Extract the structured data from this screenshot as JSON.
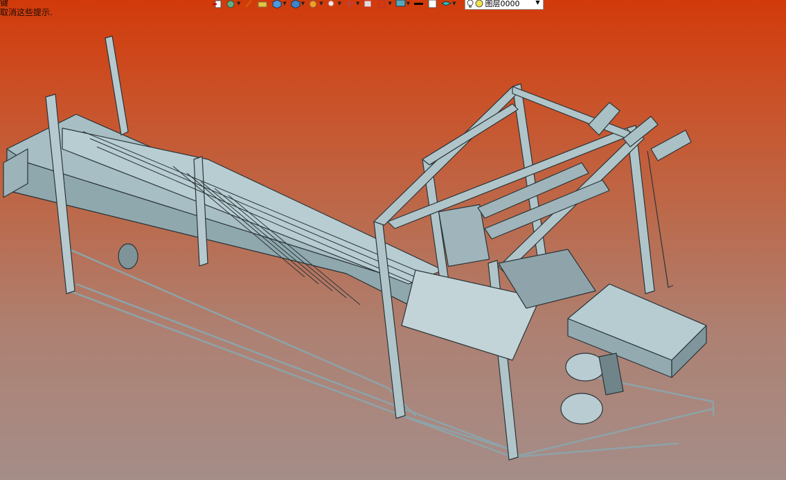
{
  "status_hint": {
    "line1": "键",
    "line2": "取消这些提示."
  },
  "toolbar": {
    "icons": [
      "insert-icon",
      "rebuild-icon",
      "sketch-icon",
      "color-icon",
      "box-icon",
      "view-orient-icon",
      "render-icon",
      "zoom-icon",
      "section-icon",
      "display-icon",
      "hide-icon",
      "monitor-icon",
      "line-color-icon",
      "fill-color-icon",
      "layer-stack-icon",
      "bulb-icon",
      "layer-dot-icon"
    ],
    "layer_name": "图层0000"
  },
  "colors": {
    "machine": "#aac0c6",
    "edge": "#2a3438",
    "bg_top": "#d23a0a",
    "bg_bottom": "#a58d88"
  }
}
